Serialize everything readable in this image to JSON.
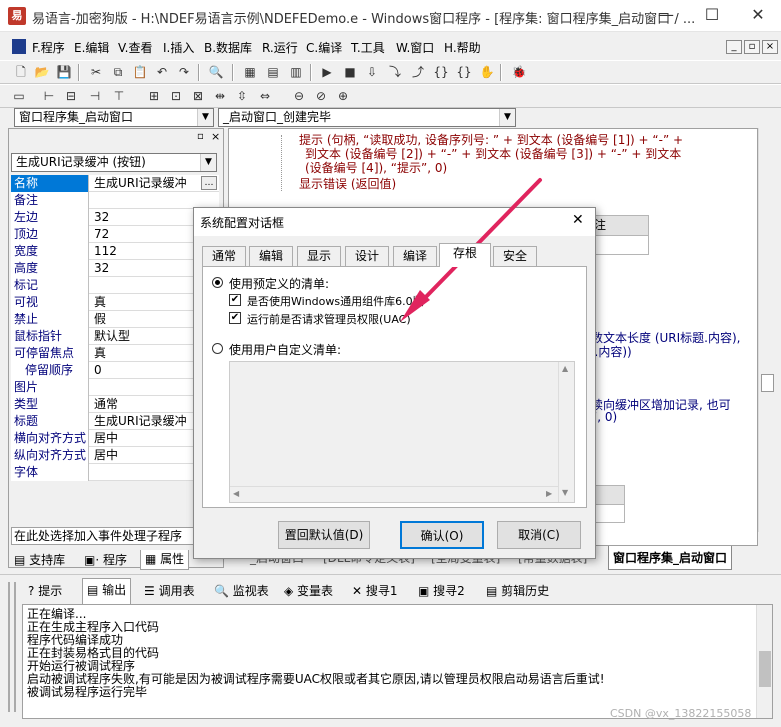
{
  "window": {
    "title": "易语言-加密狗版 - H:\\NDEF易语言示例\\NDEFEDemo.e - Windows窗口程序 - [程序集: 窗口程序集_启动窗口 / ...",
    "app_icon": "易"
  },
  "menu": [
    "F.程序",
    "E.编辑",
    "V.查看",
    "I.插入",
    "B.数据库",
    "R.运行",
    "C.编译",
    "T.工具",
    "W.窗口",
    "H.帮助"
  ],
  "combos": {
    "assembly": "窗口程序集_启动窗口",
    "subroutine": "_启动窗口_创建完毕",
    "component": "生成URI记录缓冲 (按钮)"
  },
  "properties": [
    {
      "k": "名称",
      "v": "生成URI记录缓冲"
    },
    {
      "k": "备注",
      "v": ""
    },
    {
      "k": "左边",
      "v": "32"
    },
    {
      "k": "顶边",
      "v": "72"
    },
    {
      "k": "宽度",
      "v": "112"
    },
    {
      "k": "高度",
      "v": "32"
    },
    {
      "k": "标记",
      "v": ""
    },
    {
      "k": "可视",
      "v": "真"
    },
    {
      "k": "禁止",
      "v": "假"
    },
    {
      "k": "鼠标指针",
      "v": "默认型"
    },
    {
      "k": "可停留焦点",
      "v": "真"
    },
    {
      "k": "停留顺序",
      "v": "0"
    },
    {
      "k": "图片",
      "v": ""
    },
    {
      "k": "类型",
      "v": "通常"
    },
    {
      "k": "标题",
      "v": "生成URI记录缓冲"
    },
    {
      "k": "横向对齐方式",
      "v": "居中"
    },
    {
      "k": "纵向对齐方式",
      "v": "居中"
    },
    {
      "k": "字体",
      "v": ""
    }
  ],
  "prop_hint": "在此处选择加入事件处理子程序",
  "left_tabs": [
    "支持库",
    "程序",
    "属性"
  ],
  "code": {
    "l1": "提示 (句柄, “读取成功, 设备序列号: ” + 到文本 (设备编号 [1]) + “-” +",
    "l2": "到文本 (设备编号 [2]) + “-” + 到文本 (设备编号 [3]) + “-” + 到文本",
    "l3": "(设备编号 [4]), “提示”, 0)",
    "l4": "显示错误 (返回值)",
    "r1": "数文本长度 (URI标题.内容),",
    "r2": "I.内容))",
    "r3": "续向缓冲区增加记录, 也可",
    "r4": "”, 0)",
    "hdr": "注"
  },
  "code_tabs": [
    "_启动窗口",
    "[DLL命令定义表]",
    "[全局变量表]",
    "[常量数据表]",
    "窗口程序集_启动窗口"
  ],
  "dialog": {
    "title": "系统配置对话框",
    "close": "✕",
    "tabs": [
      "通常",
      "编辑",
      "显示",
      "设计",
      "编译",
      "存根",
      "安全"
    ],
    "active_tab": "存根",
    "radio_predef": "使用预定义的清单:",
    "check_win6": "是否使用Windows通用组件库6.0版",
    "check_uac": "运行前是否请求管理员权限(UAC)",
    "radio_custom": "使用用户自定义清单:",
    "btn_reset": "置回默认值(D)",
    "btn_ok": "确认(O)",
    "btn_cancel": "取消(C)"
  },
  "bottom_tabs": [
    "提示",
    "输出",
    "调用表",
    "监视表",
    "变量表",
    "搜寻1",
    "搜寻2",
    "剪辑历史"
  ],
  "output": [
    "正在编译...",
    "正在生成主程序入口代码",
    "程序代码编译成功",
    "正在封装易格式目的代码",
    "开始运行被调试程序",
    "启动被调试程序失败,有可能是因为被调试程序需要UAC权限或者其它原因,请以管理员权限启动易语言后重试!",
    "被调试易程序运行完毕"
  ],
  "watermark": "CSDN @vx_13822155058",
  "accent": "#e0245e"
}
